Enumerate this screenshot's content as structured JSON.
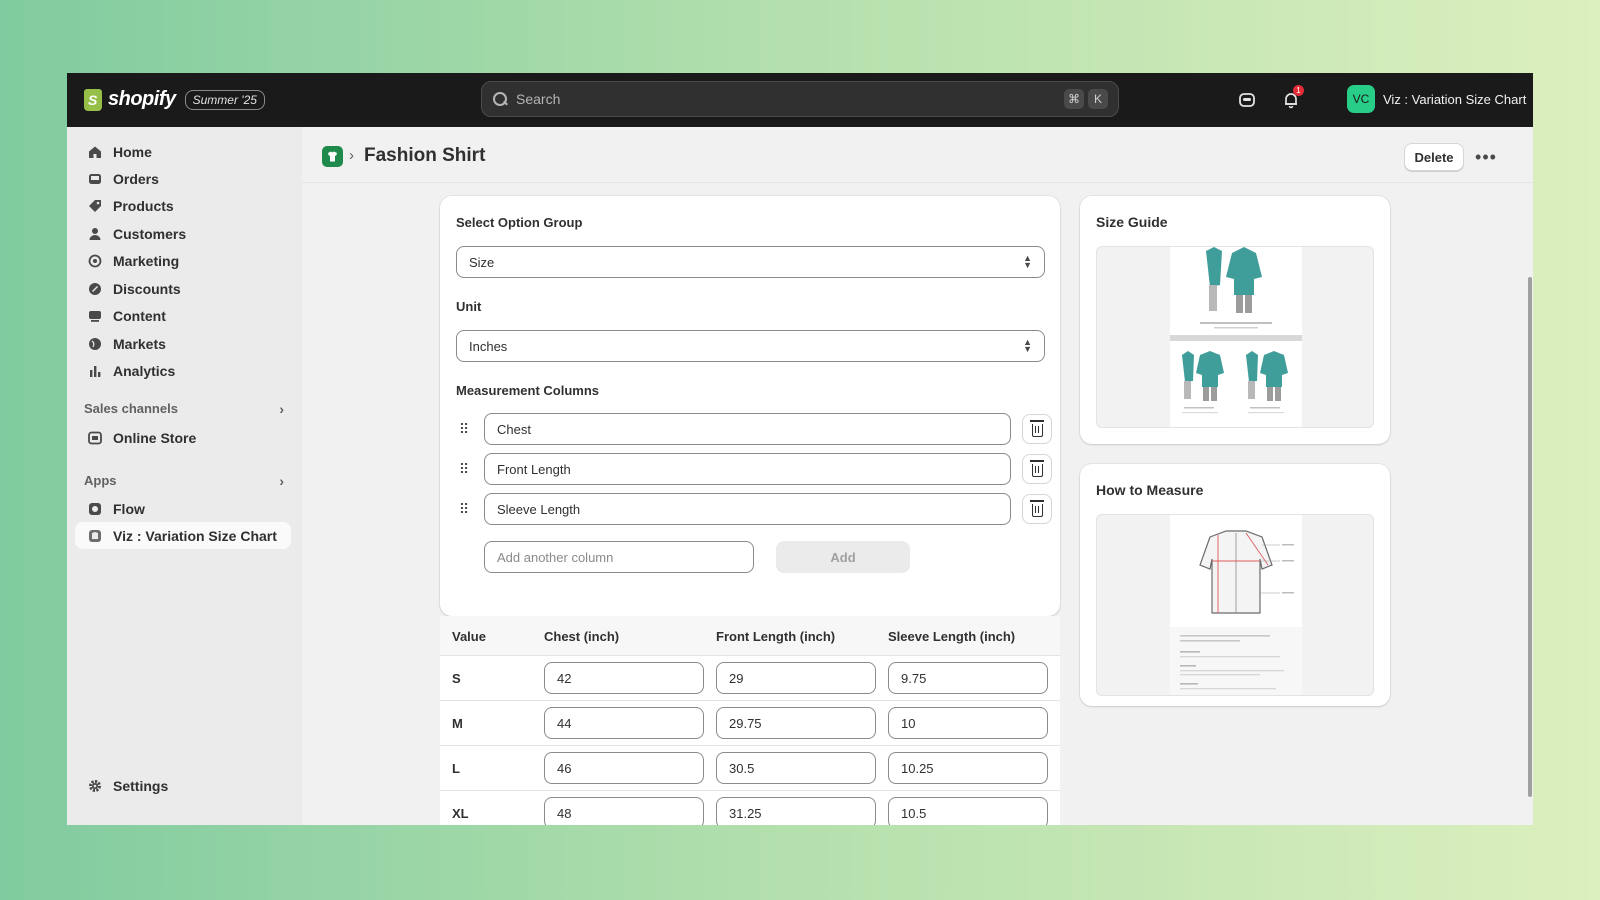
{
  "topbar": {
    "brand": "shopify",
    "edition": "Summer '25",
    "search_placeholder": "Search",
    "shortcut_keys": [
      "⌘",
      "K"
    ],
    "notification_count": "1",
    "account_initials": "VC",
    "account_name": "Viz : Variation Size Chart"
  },
  "sidebar": {
    "items": [
      {
        "label": "Home",
        "icon": "home-icon"
      },
      {
        "label": "Orders",
        "icon": "inbox-icon"
      },
      {
        "label": "Products",
        "icon": "tag-icon"
      },
      {
        "label": "Customers",
        "icon": "person-icon"
      },
      {
        "label": "Marketing",
        "icon": "target-icon"
      },
      {
        "label": "Discounts",
        "icon": "discount-icon"
      },
      {
        "label": "Content",
        "icon": "content-icon"
      },
      {
        "label": "Markets",
        "icon": "globe-icon"
      },
      {
        "label": "Analytics",
        "icon": "bar-chart-icon"
      }
    ],
    "sales_channels_label": "Sales channels",
    "online_store": "Online Store",
    "apps_label": "Apps",
    "flow": "Flow",
    "viz_app": "Viz : Variation Size Chart",
    "settings": "Settings"
  },
  "page": {
    "title": "Fashion Shirt",
    "delete_label": "Delete"
  },
  "form": {
    "option_group_label": "Select Option Group",
    "option_group_value": "Size",
    "unit_label": "Unit",
    "unit_value": "Inches",
    "columns_label": "Measurement Columns",
    "columns": [
      "Chest",
      "Front Length",
      "Sleeve Length"
    ],
    "add_column_placeholder": "Add another column",
    "add_label": "Add"
  },
  "table": {
    "headers": [
      "Value",
      "Chest (inch)",
      "Front Length (inch)",
      "Sleeve Length (inch)"
    ],
    "rows": [
      {
        "value": "S",
        "cells": [
          "42",
          "29",
          "9.75"
        ]
      },
      {
        "value": "M",
        "cells": [
          "44",
          "29.75",
          "10"
        ]
      },
      {
        "value": "L",
        "cells": [
          "46",
          "30.5",
          "10.25"
        ]
      },
      {
        "value": "XL",
        "cells": [
          "48",
          "31.25",
          "10.5"
        ]
      }
    ]
  },
  "size_guide": {
    "title": "Size Guide"
  },
  "how_to_measure": {
    "title": "How to Measure"
  },
  "colors": {
    "topbar": "#1a1a1a",
    "avatar": "#28cd88",
    "shirt": "#3f9d9a",
    "app_icon": "#1e8a4c",
    "notification": "#e22c38"
  }
}
